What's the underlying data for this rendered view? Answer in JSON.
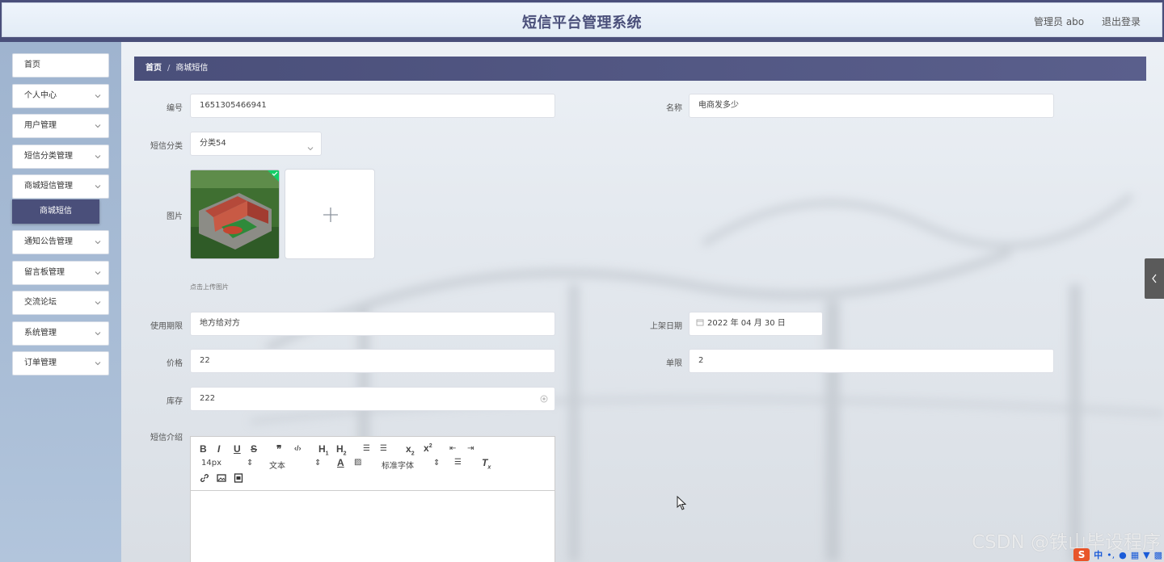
{
  "header": {
    "title": "短信平台管理系统",
    "user_label": "管理员 abo",
    "logout_label": "退出登录"
  },
  "sidebar": {
    "items": [
      {
        "label": "首页",
        "expandable": false
      },
      {
        "label": "个人中心",
        "expandable": true
      },
      {
        "label": "用户管理",
        "expandable": true
      },
      {
        "label": "短信分类管理",
        "expandable": true
      },
      {
        "label": "商城短信管理",
        "expandable": true,
        "expanded": true
      },
      {
        "label": "通知公告管理",
        "expandable": true
      },
      {
        "label": "留言板管理",
        "expandable": true
      },
      {
        "label": "交流论坛",
        "expandable": true
      },
      {
        "label": "系统管理",
        "expandable": true
      },
      {
        "label": "订单管理",
        "expandable": true
      }
    ],
    "active_sub_item": "商城短信"
  },
  "breadcrumb": {
    "home": "首页",
    "separator": "/",
    "current": "商城短信"
  },
  "form": {
    "id_label": "编号",
    "id_value": "1651305466941",
    "name_label": "名称",
    "name_value": "电商发多少",
    "category_label": "短信分类",
    "category_value": "分类54",
    "image_label": "图片",
    "upload_hint": "点击上传图片",
    "validity_label": "使用期限",
    "validity_value": "地方给对方",
    "shelf_date_label": "上架日期",
    "shelf_date_value": "2022 年 04 月 30 日",
    "price_label": "价格",
    "price_value": "22",
    "limit_label": "单限",
    "limit_value": "2",
    "stock_label": "库存",
    "stock_value": "222",
    "intro_label": "短信介绍"
  },
  "editor": {
    "font_size": "14px",
    "text_type": "文本",
    "font_family": "标准字体",
    "buttons_row1": [
      "B",
      "I",
      "U",
      "S",
      "99",
      "</>",
      "H1",
      "H2",
      "ol",
      "ul",
      "x2",
      "x2",
      "indent-less",
      "indent-more"
    ],
    "icons_row3": [
      "link-icon",
      "image-icon",
      "video-icon"
    ]
  },
  "watermark": "CSDN @铁山毕设程序",
  "colors": {
    "primary": "#4a4f7a",
    "sidebar_bg": "#a9bdd6",
    "upload_check": "#13ce66"
  }
}
